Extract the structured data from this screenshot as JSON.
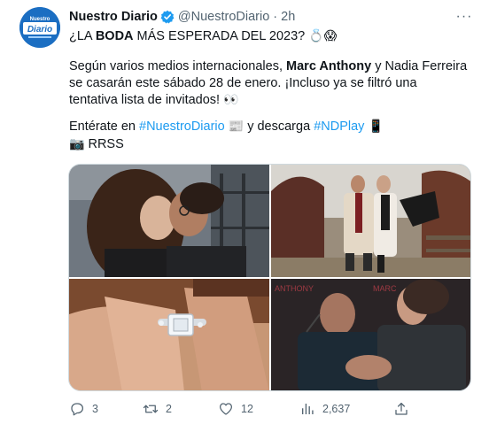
{
  "author": {
    "name": "Nuestro Diario",
    "handle": "@NuestroDiario",
    "separator": "·",
    "time": "2h",
    "avatar_text": "Nuestro Diario",
    "verified": true
  },
  "more_menu": "···",
  "tweet": {
    "line1_pre": "¿LA ",
    "line1_bold": "BODA",
    "line1_post": " MÁS ESPERADA DEL 2023? ",
    "line1_emoji": "💍😱",
    "p2_pre": "Según varios medios internacionales, ",
    "p2_bold": "Marc Anthony",
    "p2_post": " y Nadia Ferreira se casarán este sábado 28 de enero. ¡Incluso ya se filtró una tentativa lista de invitados! ",
    "p2_emoji": "👀",
    "p3_pre": "Entérate en ",
    "p3_link1": "#NuestroDiario",
    "p3_emoji1": "📰",
    "p3_mid": " y descarga ",
    "p3_link2": "#NDPlay",
    "p3_emoji2": "📱",
    "p4_emoji": "📷",
    "p4_text": " RRSS"
  },
  "media": {
    "overlay_text_left": "ANTHONY",
    "overlay_text_right": "MARC"
  },
  "actions": {
    "replies": "3",
    "retweets": "2",
    "likes": "12",
    "views": "2,637"
  },
  "colors": {
    "link": "#1d9bf0",
    "muted": "#536471",
    "text": "#0f1419",
    "verified": "#1d9bf0",
    "avatar_bg": "#1b6ec2"
  }
}
